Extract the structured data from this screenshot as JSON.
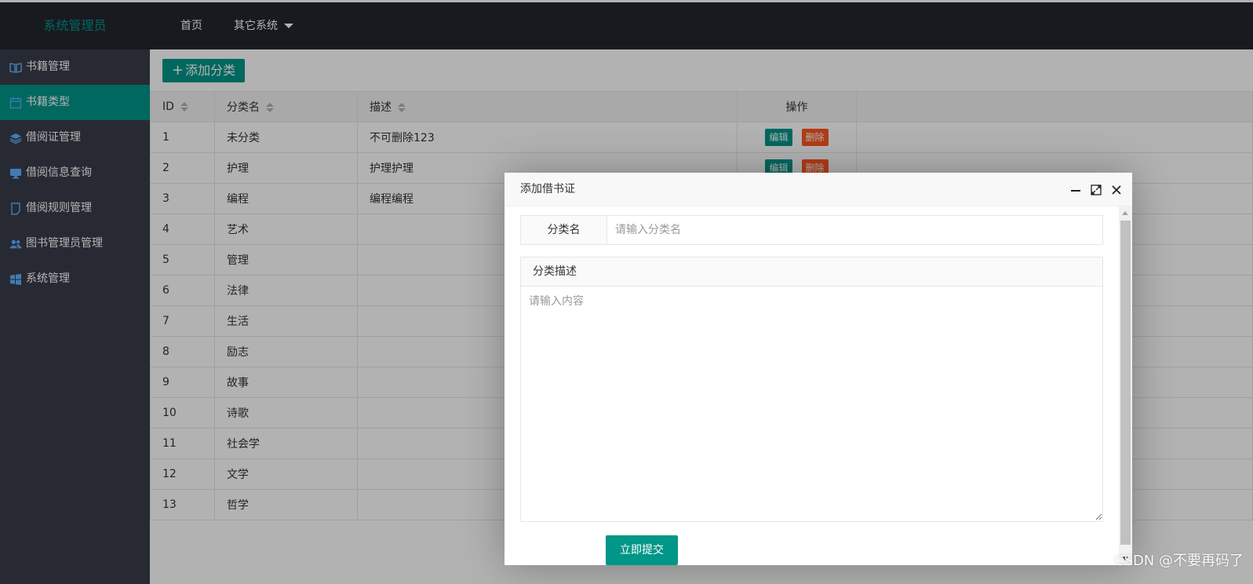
{
  "header": {
    "logo": "系统管理员",
    "nav": [
      {
        "label": "首页"
      },
      {
        "label": "其它系统"
      }
    ]
  },
  "sidebar": {
    "items": [
      {
        "label": "书籍管理",
        "icon": "book-icon"
      },
      {
        "label": "书籍类型",
        "icon": "calendar-icon",
        "active": true
      },
      {
        "label": "借阅证管理",
        "icon": "layers-icon"
      },
      {
        "label": "借阅信息查询",
        "icon": "monitor-icon"
      },
      {
        "label": "借阅规则管理",
        "icon": "note-icon"
      },
      {
        "label": "图书管理员管理",
        "icon": "users-icon"
      },
      {
        "label": "系统管理",
        "icon": "windows-icon"
      }
    ]
  },
  "main": {
    "add_button": "添加分类",
    "table": {
      "columns": [
        "ID",
        "分类名",
        "描述",
        "操作"
      ],
      "rows": [
        {
          "id": "1",
          "name": "未分类",
          "desc": "不可删除123"
        },
        {
          "id": "2",
          "name": "护理",
          "desc": "护理护理"
        },
        {
          "id": "3",
          "name": "编程",
          "desc": "编程编程"
        },
        {
          "id": "4",
          "name": "艺术",
          "desc": ""
        },
        {
          "id": "5",
          "name": "管理",
          "desc": ""
        },
        {
          "id": "6",
          "name": "法律",
          "desc": ""
        },
        {
          "id": "7",
          "name": "生活",
          "desc": ""
        },
        {
          "id": "8",
          "name": "励志",
          "desc": ""
        },
        {
          "id": "9",
          "name": "故事",
          "desc": ""
        },
        {
          "id": "10",
          "name": "诗歌",
          "desc": ""
        },
        {
          "id": "11",
          "name": "社会学",
          "desc": ""
        },
        {
          "id": "12",
          "name": "文学",
          "desc": ""
        },
        {
          "id": "13",
          "name": "哲学",
          "desc": ""
        }
      ],
      "edit_label": "编辑",
      "delete_label": "删除"
    }
  },
  "modal": {
    "title": "添加借书证",
    "name_label": "分类名",
    "name_placeholder": "请输入分类名",
    "name_value": "",
    "desc_label": "分类描述",
    "desc_placeholder": "请输入内容",
    "submit_label": "立即提交"
  },
  "watermark": "CSDN @不要再码了",
  "colors": {
    "accent": "#009688",
    "danger": "#ff5722",
    "sidebar_bg": "#393d49",
    "topbar_bg": "#23262e"
  }
}
